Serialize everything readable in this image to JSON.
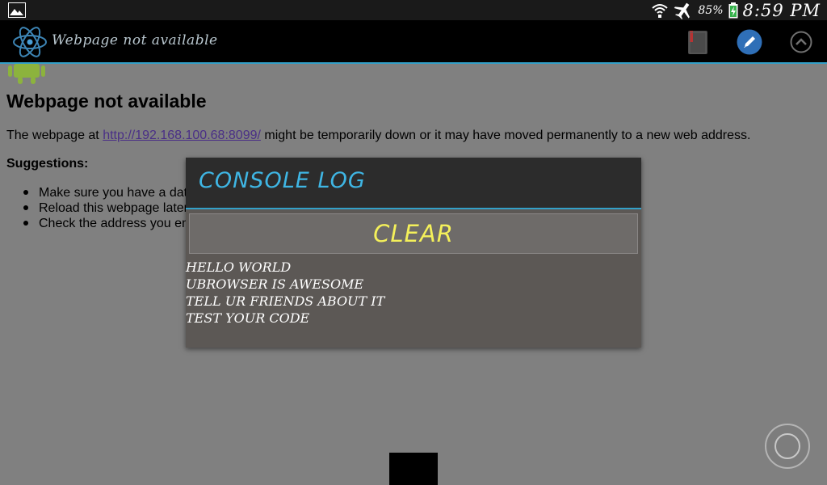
{
  "status_bar": {
    "battery_percent": "85%",
    "time": "8:59 PM",
    "icons": [
      "gallery-icon",
      "wifi-icon",
      "airplane-icon",
      "battery-icon"
    ]
  },
  "action_bar": {
    "title": "Webpage not available",
    "icons": [
      "atom-logo-icon",
      "bookmark-icon",
      "edit-icon",
      "chevron-up-icon"
    ]
  },
  "page": {
    "title": "Webpage not available",
    "body_prefix": "The webpage at ",
    "url": "http://192.168.100.68:8099/",
    "body_suffix": " might be temporarily down or it may have moved permanently to a new web address.",
    "suggestions_label": "Suggestions:",
    "suggestions": [
      "Make sure you have a dat",
      "Reload this webpage later",
      "Check the address you en"
    ]
  },
  "console_dialog": {
    "title": "CONSOLE LOG",
    "clear_label": "CLEAR",
    "log_lines": [
      "HELLO WORLD",
      "UBROWSER IS AWESOME",
      "TELL UR FRIENDS ABOUT IT",
      "TEST YOUR CODE"
    ]
  },
  "colors": {
    "accent": "#33a0c8",
    "dialog_title": "#3fb6e4",
    "clear_text": "#f4f05a",
    "page_bg": "#808080"
  }
}
